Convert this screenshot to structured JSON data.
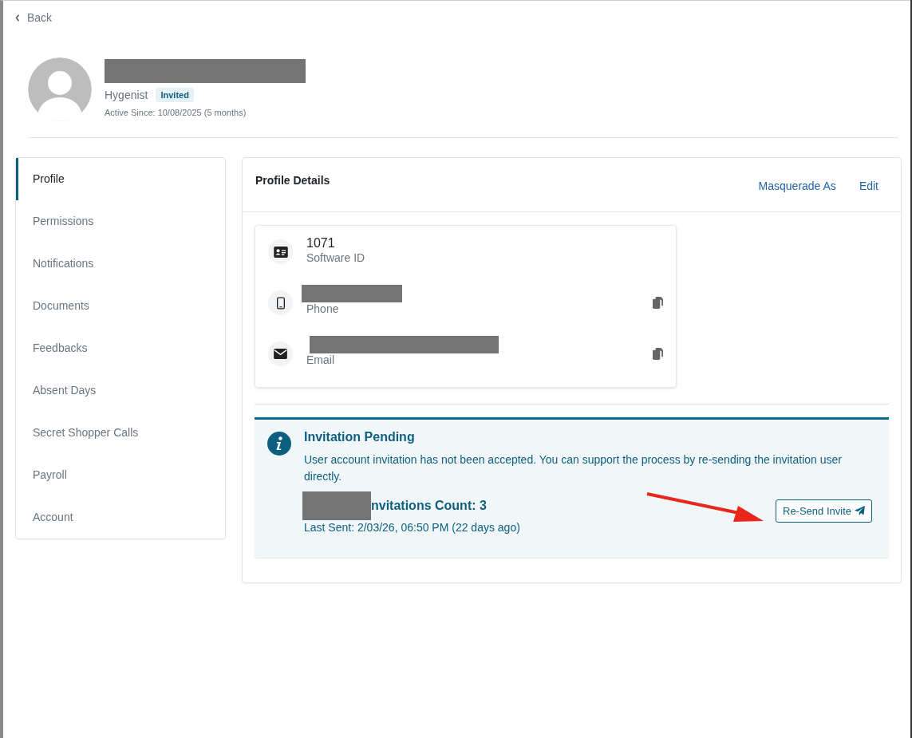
{
  "back": "Back",
  "user": {
    "name_redacted": true,
    "role": "Hygenist",
    "status": "Invited",
    "active_since": "Active Since: 10/08/2025 (5 months)"
  },
  "sidebar": {
    "items": [
      {
        "label": "Profile",
        "selected": true
      },
      {
        "label": "Permissions",
        "selected": false
      },
      {
        "label": "Notifications",
        "selected": false
      },
      {
        "label": "Documents",
        "selected": false
      },
      {
        "label": "Feedbacks",
        "selected": false
      },
      {
        "label": "Absent Days",
        "selected": false
      },
      {
        "label": "Secret Shopper Calls",
        "selected": false
      },
      {
        "label": "Payroll",
        "selected": false
      },
      {
        "label": "Account",
        "selected": false
      }
    ]
  },
  "profile": {
    "title": "Profile Details",
    "actions": [
      "Masquerade As",
      "Edit"
    ],
    "fields": [
      {
        "kind": "id",
        "value": "1071",
        "label": "Software ID",
        "copyable": false
      },
      {
        "kind": "phone",
        "value_redacted": true,
        "label": "Phone",
        "copyable": true
      },
      {
        "kind": "email",
        "value_redacted": true,
        "label": "Email",
        "copyable": true
      }
    ]
  },
  "alert": {
    "title": "Invitation Pending",
    "message": "User account invitation has not been accepted. You can support the process by re-sending the invitation user directly.",
    "count_redacted": true,
    "count": "nvitations Count: 3",
    "last_sent": "Last Sent: 2/03/26, 06:50 PM (22 days ago)",
    "button": "Re-Send Invite",
    "annotation_arrow": true
  }
}
